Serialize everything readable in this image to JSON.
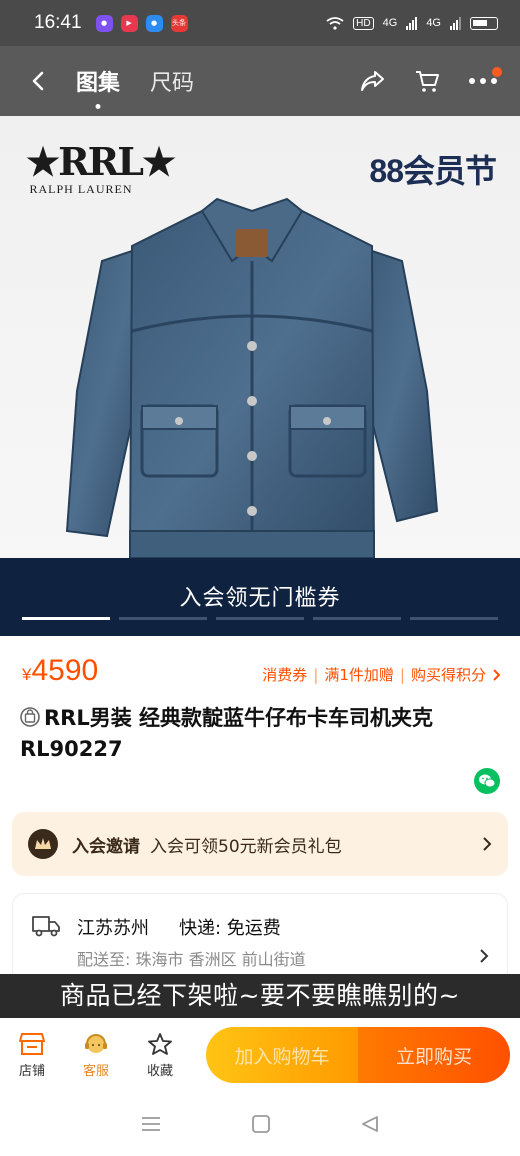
{
  "status_bar": {
    "time": "16:41",
    "network_hd": "HD",
    "network_1": "4G",
    "network_2": "4G",
    "notification_badge": "头条"
  },
  "nav": {
    "tabs": [
      {
        "label": "图集",
        "active": true
      },
      {
        "label": "尺码",
        "active": false
      }
    ],
    "icons": [
      "back-icon",
      "share-icon",
      "cart-icon",
      "more-icon"
    ]
  },
  "hero": {
    "brand_mark": "★RRL★",
    "brand_name": "RALPH LAUREN",
    "promo": "88会员节"
  },
  "coupon_banner": {
    "text": "入会领无门槛券",
    "slides": 5,
    "current": 1
  },
  "price": {
    "currency": "¥",
    "amount": "4590",
    "benefits": [
      "消费券",
      "满1件加赠",
      "购买得积分"
    ]
  },
  "product": {
    "title": "RRL男装 经典款靛蓝牛仔布卡车司机夹克RL90227"
  },
  "member": {
    "title": "入会邀请",
    "desc": "入会可领50元新会员礼包"
  },
  "shipping": {
    "origin": "江苏苏州",
    "method": "快递: 免运费",
    "deliver_to": "配送至: 珠海市 香洲区 前山街道"
  },
  "toast": "商品已经下架啦~要不要瞧瞧别的~",
  "action_bar": {
    "store": "店铺",
    "service": "客服",
    "favorite": "收藏",
    "add_to_cart": "加入购物车",
    "buy_now": "立即购买"
  },
  "colors": {
    "accent": "#ff5000",
    "banner": "#0f2240",
    "member_bg": "#fdf1e2"
  }
}
